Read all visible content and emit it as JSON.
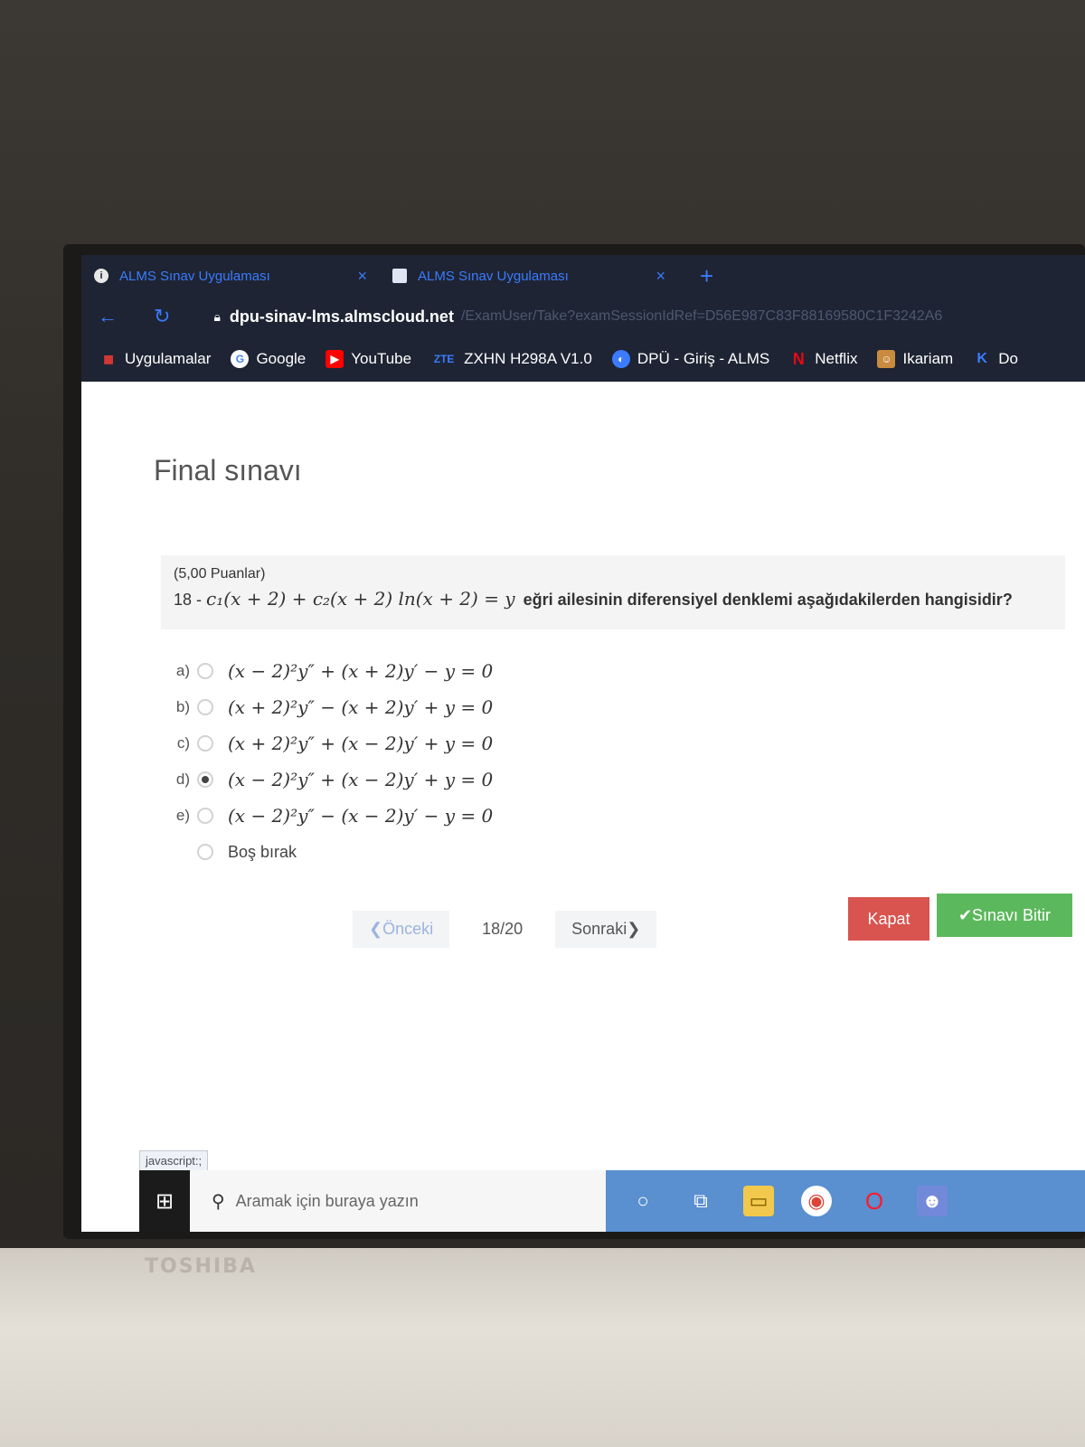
{
  "browser": {
    "tabs": [
      {
        "label": "ALMS Sınav Uygulaması",
        "close": "×"
      },
      {
        "label": "ALMS Sınav Uygulaması",
        "close": "×"
      }
    ],
    "new_tab": "+",
    "url_host": "dpu-sinav-lms.almscloud.net",
    "url_path": "/ExamUser/Take?examSessionIdRef=D56E987C83F88169580C1F3242A6",
    "bookmarks": [
      {
        "label": "Uygulamalar",
        "icon": "apps-grid-icon"
      },
      {
        "label": "Google",
        "icon": "google-icon"
      },
      {
        "label": "YouTube",
        "icon": "youtube-icon"
      },
      {
        "label": "ZXHN H298A V1.0",
        "icon": "zte-icon"
      },
      {
        "label": "DPÜ - Giriş - ALMS",
        "icon": "alms-icon"
      },
      {
        "label": "Netflix",
        "icon": "netflix-icon"
      },
      {
        "label": "Ikariam",
        "icon": "ikariam-icon"
      },
      {
        "label": "Do",
        "icon": "k-icon"
      }
    ]
  },
  "exam": {
    "title": "Final sınavı",
    "question": {
      "points": "(5,00 Puanlar)",
      "number": "18 -",
      "formula": "c₁(x + 2) + c₂(x + 2) ln(x + 2) = y",
      "text": "eğri ailesinin diferensiyel denklemi aşağıdakilerden hangisidir?"
    },
    "options": [
      {
        "letter": "a)",
        "expr": "(x − 2)²y″ + (x + 2)y′ − y = 0",
        "selected": false
      },
      {
        "letter": "b)",
        "expr": "(x + 2)²y″ − (x + 2)y′ + y = 0",
        "selected": false
      },
      {
        "letter": "c)",
        "expr": "(x + 2)²y″ + (x − 2)y′ + y = 0",
        "selected": false
      },
      {
        "letter": "d)",
        "expr": "(x − 2)²y″ + (x − 2)y′ + y = 0",
        "selected": true
      },
      {
        "letter": "e)",
        "expr": "(x − 2)²y″ − (x − 2)y′ − y = 0",
        "selected": false
      }
    ],
    "skip_label": "Boş bırak",
    "prev_label": "❮Önceki",
    "page_count": "18/20",
    "next_label": "Sonraki❯",
    "close_label": "Kapat",
    "finish_label": "✔Sınavı Bitir"
  },
  "status_text": "javascript:;",
  "taskbar": {
    "search_placeholder": "Aramak için buraya yazın"
  },
  "device_brand": "TOSHIBA",
  "colors": {
    "close_button": "#d9534f",
    "finish_button": "#5cb85c",
    "browser_chrome": "#1e2433",
    "accent": "#3a7bff"
  }
}
